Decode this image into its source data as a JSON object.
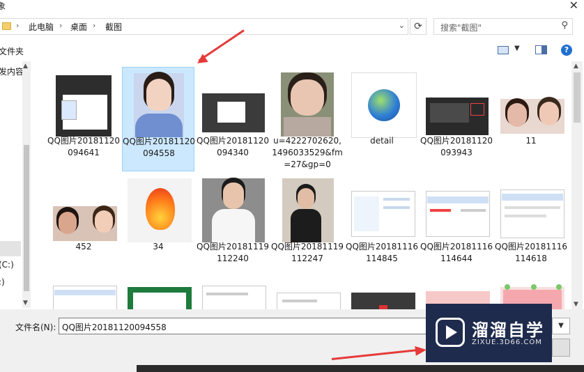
{
  "window": {
    "title": "象",
    "close_glyph": "✕"
  },
  "address_bar": {
    "crumbs": [
      "此电脑",
      "桌面",
      "截图"
    ],
    "separator": "›",
    "dropdown_glyph": "⌄",
    "refresh_glyph": "⟳"
  },
  "search": {
    "placeholder": "搜索\"截图\"",
    "icon": "search-icon"
  },
  "toolbar": {
    "new_folder": "文件夹",
    "view_dropdown": "▼",
    "help": "?"
  },
  "nav": {
    "items": [
      "发内容",
      "(C:)",
      ":)"
    ]
  },
  "files": [
    {
      "name": "QQ图片20181120094641",
      "kind": "screenshot-dark"
    },
    {
      "name": "QQ图片20181120094558",
      "kind": "portrait-woman",
      "selected": true
    },
    {
      "name": "QQ图片20181120094340",
      "kind": "screenshot-ps"
    },
    {
      "name": "u=4222702620,1496033529&fm=27&gp=0",
      "kind": "selfie"
    },
    {
      "name": "detail",
      "kind": "globe"
    },
    {
      "name": "QQ图片20181120093943",
      "kind": "screenshot-dark2"
    },
    {
      "name": "11",
      "kind": "couple"
    },
    {
      "name": "452",
      "kind": "couple2"
    },
    {
      "name": "34",
      "kind": "fire"
    },
    {
      "name": "QQ图片20181119112240",
      "kind": "man-white"
    },
    {
      "name": "QQ图片20181119112247",
      "kind": "man-black"
    },
    {
      "name": "QQ图片20181116114845",
      "kind": "dialog"
    },
    {
      "name": "QQ图片20181116114644",
      "kind": "dialog2"
    },
    {
      "name": "QQ图片20181116114618",
      "kind": "dialog3"
    },
    {
      "name": "",
      "kind": "doc"
    },
    {
      "name": "",
      "kind": "green"
    },
    {
      "name": "",
      "kind": "doc2"
    },
    {
      "name": "",
      "kind": "doc3"
    },
    {
      "name": "",
      "kind": "keyboard"
    },
    {
      "name": "",
      "kind": "pink-dark"
    },
    {
      "name": "",
      "kind": "pink"
    }
  ],
  "bottom": {
    "filename_label": "文件名(N):",
    "filename_value": "QQ图片20181120094558",
    "filter_glyph": "▼"
  },
  "watermark": {
    "brand": "溜溜自学",
    "url": "ZIXUE.3D66.COM"
  },
  "colors": {
    "selection": "#cce8ff",
    "arrow": "#e63a3a",
    "help": "#1f6fd0"
  }
}
